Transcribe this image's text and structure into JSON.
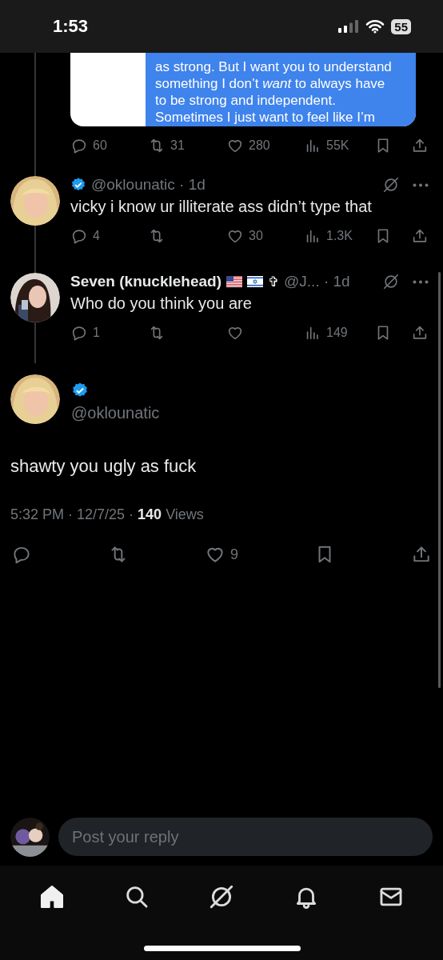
{
  "status_bar": {
    "time": "1:53",
    "battery": "55"
  },
  "parent_post": {
    "image_lines": [
      "as strong. But I want you to understand",
      "something I don’t *want* to always have",
      "to be strong and independent.",
      "Sometimes I just want to feel like I’m"
    ],
    "actions": {
      "replies": "60",
      "reposts": "31",
      "likes": "280",
      "views": "55K"
    }
  },
  "replies": [
    {
      "verified": true,
      "handle_time": "@oklounatic · 1d",
      "text": "vicky i know ur illiterate ass didn’t type that",
      "actions": {
        "replies": "4",
        "likes": "30",
        "views": "1.3K"
      }
    },
    {
      "name": "Seven (knucklehead)",
      "verified": false,
      "flags": [
        {
          "kind": "us"
        },
        {
          "kind": "israel"
        }
      ],
      "name_suffix": "✞",
      "handle_time": "@J... · 1d",
      "text": "Who do you think you are",
      "actions": {
        "replies": "1",
        "views": "149"
      }
    }
  ],
  "main_post": {
    "verified": true,
    "handle": "@oklounatic",
    "text": "shawty you ugly as fuck",
    "timestamp": "5:32 PM · 12/7/25 · **140** Views",
    "actions": {
      "likes": "9"
    }
  },
  "reply_bar": {
    "placeholder": "Post your reply"
  },
  "tab_bar": [
    {
      "kind": "home",
      "selected": true
    },
    {
      "kind": "search",
      "selected": false
    },
    {
      "kind": "grok",
      "selected": false
    },
    {
      "kind": "notifications",
      "selected": false
    },
    {
      "kind": "messages",
      "selected": false
    }
  ]
}
